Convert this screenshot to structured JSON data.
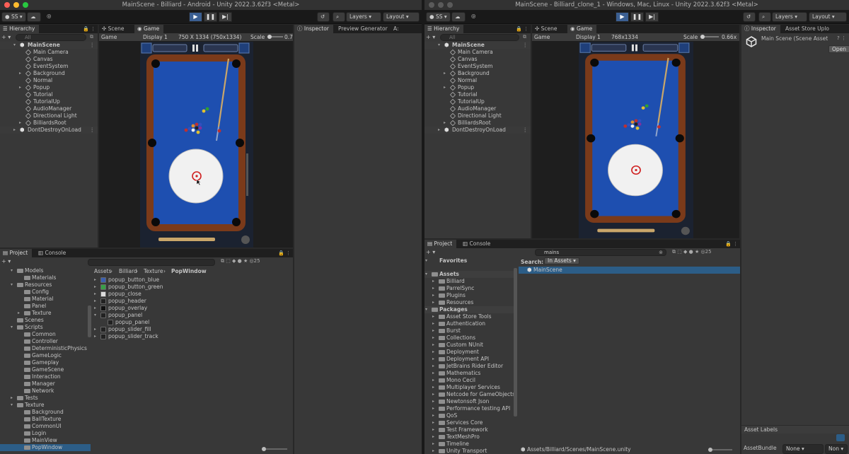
{
  "left": {
    "title": "MainScene - Billiard - Android - Unity 2022.3.62f3 <Metal>",
    "account": "SS",
    "layers": "Layers",
    "layout": "Layout",
    "hierarchy": {
      "tab": "Hierarchy",
      "search": "All",
      "scene": "MainScene",
      "items": [
        "Main Camera",
        "Canvas",
        "EventSystem",
        "Background",
        "Normal",
        "Popup",
        "Tutorial",
        "TutorialUp",
        "AudioManager",
        "Directional Light",
        "BilliardsRoot"
      ],
      "dont": "DontDestroyOnLoad"
    },
    "scene_tab": "Scene",
    "game_tab": "Game",
    "game_bar": {
      "mode": "Game",
      "display": "Display 1",
      "resolution": "750 X 1334 (750x1334)",
      "scale_label": "Scale",
      "scale_value": "0.7"
    },
    "inspector": {
      "tab": "Inspector",
      "tab2": "Preview Generator",
      "tab3": "A:"
    },
    "project": {
      "tab": "Project",
      "tab2": "Console",
      "count": "25",
      "tree": [
        "Models",
        "Materials",
        "Resources",
        "Config",
        "Material",
        "Panel",
        "Texture",
        "Scenes",
        "Scripts",
        "Common",
        "Controller",
        "DeterministicPhysics",
        "GameLogic",
        "Gameplay",
        "GameScene",
        "Interaction",
        "Manager",
        "Network",
        "Tests",
        "Texture",
        "Background",
        "BallTexture",
        "CommonUI",
        "Login",
        "MainView",
        "PopWindow"
      ],
      "breadcrumb": [
        "Assets",
        "Billiard",
        "Texture",
        "PopWindow"
      ],
      "assets": [
        "popup_button_blue",
        "popup_button_green",
        "popup_close",
        "popup_header",
        "popup_overlay",
        "popup_panel",
        "popup_panel",
        "popup_slider_fill",
        "popup_slider_track"
      ]
    }
  },
  "right": {
    "title": "MainScene - Billiard_clone_1 - Windows, Mac, Linux - Unity 2022.3.62f3 <Metal>",
    "account": "SS",
    "layers": "Layers",
    "layout": "Layout",
    "hierarchy": {
      "tab": "Hierarchy",
      "search": "All",
      "scene": "MainScene",
      "items": [
        "Main Camera",
        "Canvas",
        "EventSystem",
        "Background",
        "Normal",
        "Popup",
        "Tutorial",
        "TutorialUp",
        "AudioManager",
        "Directional Light",
        "BilliardsRoot"
      ],
      "dont": "DontDestroyOnLoad"
    },
    "scene_tab": "Scene",
    "game_tab": "Game",
    "game_bar": {
      "mode": "Game",
      "display": "Display 1",
      "resolution": "768x1334",
      "scale_label": "Scale",
      "scale_value": "0.66x"
    },
    "inspector": {
      "tab": "Inspector",
      "tab2": "Asset Store Uplo",
      "asset_name": "Main Scene (Scene Asset",
      "open": "Open",
      "labels": "Asset Labels",
      "bundle_label": "AssetBundle",
      "bundle_value": "None",
      "variant_value": "Non"
    },
    "project": {
      "tab": "Project",
      "tab2": "Console",
      "count": "25",
      "search": "mains",
      "favorites": "Favorites",
      "assets_root": "Assets",
      "assets": [
        "Billiard",
        "ParrelSync",
        "Plugins",
        "Resources"
      ],
      "packages_root": "Packages",
      "packages": [
        "Asset Store Tools",
        "Authentication",
        "Burst",
        "Collections",
        "Custom NUnit",
        "Deployment",
        "Deployment API",
        "JetBrains Rider Editor",
        "Mathematics",
        "Mono Cecil",
        "Multiplayer Services",
        "Netcode for GameObjects",
        "Newtonsoft Json",
        "Performance testing API",
        "QoS",
        "Services Core",
        "Test Framework",
        "TextMeshPro",
        "Timeline",
        "Unity Transport"
      ],
      "search_label": "Search:",
      "search_scope": "In Assets",
      "result": "MainScene",
      "path": "Assets/Billiard/Scenes/MainScene.unity"
    }
  },
  "colors": {
    "table_felt": "#1e4fb0",
    "rail": "#7a3a1a",
    "selection": "#2c5d87",
    "play_active": "#3b5f92"
  }
}
